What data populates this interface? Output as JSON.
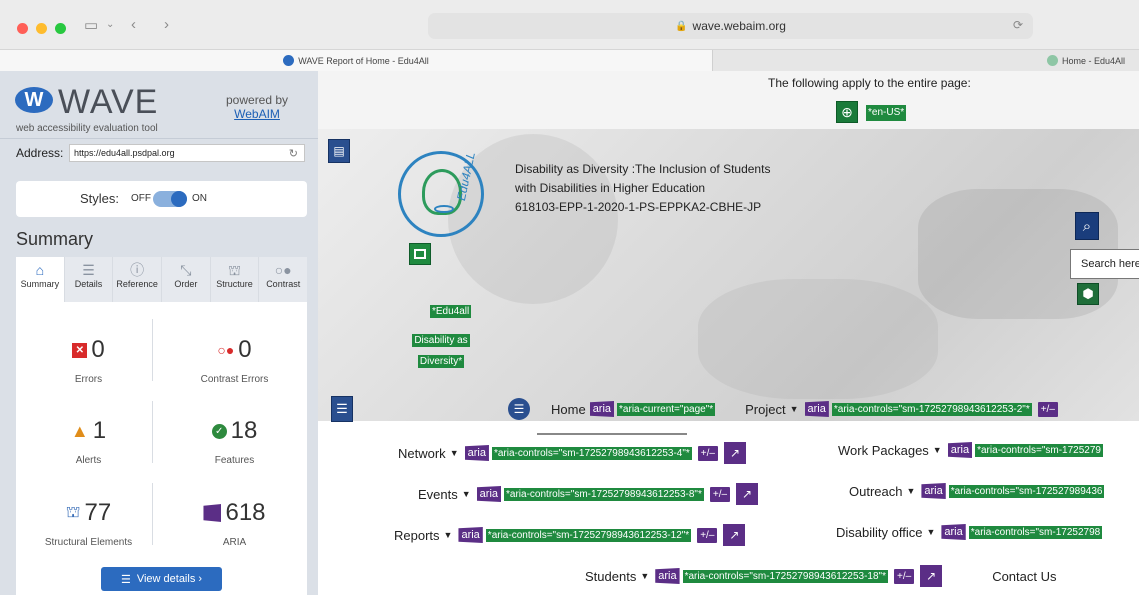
{
  "browser": {
    "url": "wave.webaim.org",
    "tabs": [
      {
        "title": "WAVE Report of Home - Edu4All",
        "active": true
      },
      {
        "title": "Home - Edu4All",
        "active": false
      }
    ]
  },
  "wave": {
    "title": "WAVE",
    "subtitle": "web accessibility evaluation tool",
    "powered_by": "powered by",
    "powered_link": "WebAIM",
    "address_label": "Address:",
    "address_value": "https://edu4all.psdpal.org",
    "styles_label": "Styles:",
    "styles_off": "OFF",
    "styles_on": "ON",
    "summary_heading": "Summary",
    "tabs": [
      {
        "label": "Summary",
        "icon": "home-icon"
      },
      {
        "label": "Details",
        "icon": "list-icon"
      },
      {
        "label": "Reference",
        "icon": "info-icon"
      },
      {
        "label": "Order",
        "icon": "order-icon"
      },
      {
        "label": "Structure",
        "icon": "structure-icon"
      },
      {
        "label": "Contrast",
        "icon": "contrast-icon"
      }
    ],
    "stats": {
      "errors": {
        "value": "0",
        "label": "Errors"
      },
      "contrast_errors": {
        "value": "0",
        "label": "Contrast Errors"
      },
      "alerts": {
        "value": "1",
        "label": "Alerts"
      },
      "features": {
        "value": "18",
        "label": "Features"
      },
      "structural": {
        "value": "77",
        "label": "Structural Elements"
      },
      "aria": {
        "value": "618",
        "label": "ARIA"
      }
    },
    "view_details": "View details ›"
  },
  "page": {
    "apply_text": "The following apply to the entire page:",
    "lang": "*en-US*",
    "hero_title_1": "Disability as Diversity :The Inclusion of Students",
    "hero_title_2": "with Disabilities in Higher Education",
    "hero_title_3": "618103-EPP-1-2020-1-PS-EPPKA2-CBHE-JP",
    "alt_1": "*Edu4all",
    "alt_2": "Disability as",
    "alt_3": "Diversity*",
    "logo_text": "Edu4ALL",
    "search_tip": "Search here",
    "aria_label": "aria",
    "pm": "+/–",
    "nav": {
      "home": "Home",
      "home_aria": "*aria-current=\"page\"*",
      "project": "Project",
      "project_aria": "*aria-controls=\"sm-17252798943612253-2\"*",
      "network": "Network",
      "network_aria": "*aria-controls=\"sm-17252798943612253-4\"*",
      "work_packages": "Work Packages",
      "work_packages_aria": "*aria-controls=\"sm-1725279",
      "events": "Events",
      "events_aria": "*aria-controls=\"sm-17252798943612253-8\"*",
      "outreach": "Outreach",
      "outreach_aria": "*aria-controls=\"sm-172527989436",
      "reports": "Reports",
      "reports_aria": "*aria-controls=\"sm-17252798943612253-12\"*",
      "disability_office": "Disability office",
      "disability_office_aria": "*aria-controls=\"sm-17252798",
      "students": "Students",
      "students_aria": "*aria-controls=\"sm-17252798943612253-18\"*",
      "contact": "Contact Us"
    }
  },
  "colors": {
    "wave_blue": "#2c6bbf",
    "aria_purple": "#5b2e86",
    "feature_green": "#1f8a3f",
    "error_red": "#d82b2b"
  }
}
